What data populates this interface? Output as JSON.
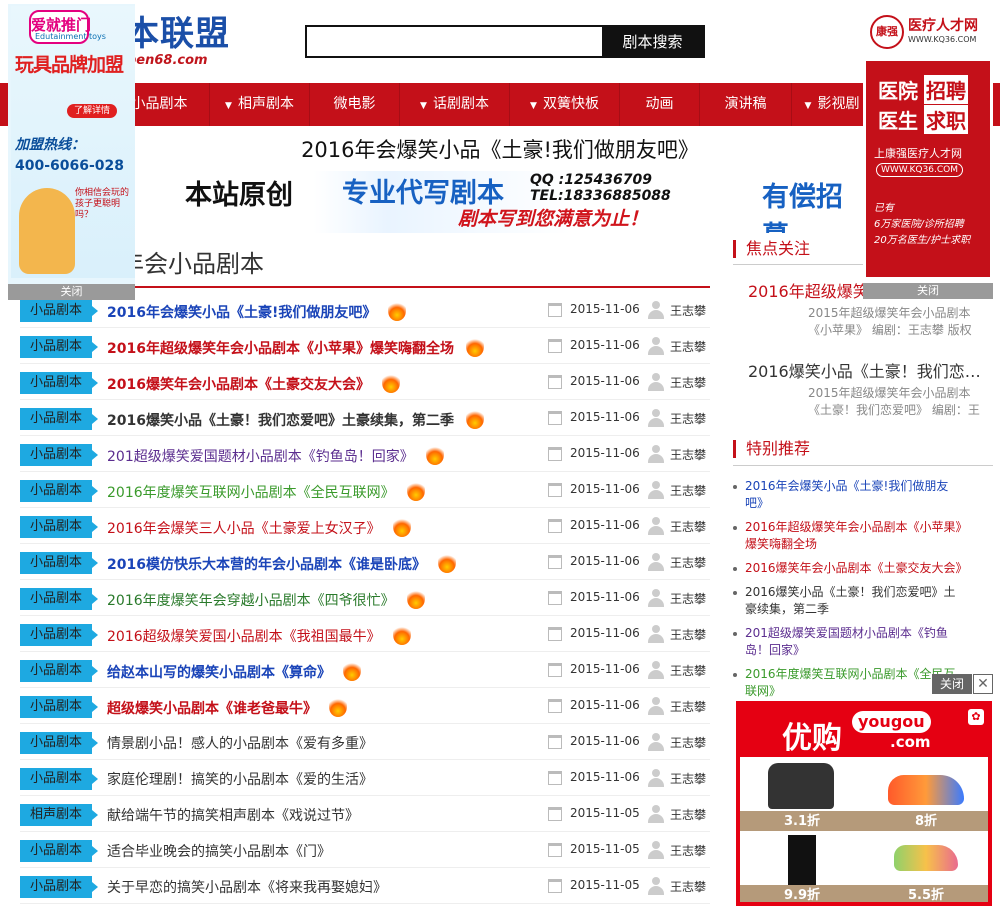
{
  "logo": {
    "text": "本联盟",
    "url_text": "ben68.com"
  },
  "search": {
    "placeholder": "",
    "button": "剧本搜索"
  },
  "nav": [
    "小品剧本",
    "相声剧本",
    "微电影",
    "话剧剧本",
    "双簧快板",
    "动画",
    "演讲稿",
    "影视剧"
  ],
  "article_title": "2016年会爆笑小品《土豪!我们做朋友吧》",
  "banner": {
    "original": "本站原创",
    "service": "专业代写剧本",
    "qq": "QQ :125436709",
    "tel": "TEL:18336885088",
    "slogan": "剧本写到您满意为止！",
    "recruit": "有偿招募"
  },
  "section_title": "年会小品剧本",
  "articles": [
    {
      "tag": "小品剧本",
      "title": "2016年会爆笑小品《土豪!我们做朋友吧》",
      "color": "#1a44b8",
      "bold": true,
      "hot": true,
      "date": "2015-11-06",
      "author": "王志攀"
    },
    {
      "tag": "小品剧本",
      "title": "2016年超级爆笑年会小品剧本《小苹果》爆笑嗨翻全场",
      "color": "#c41019",
      "bold": true,
      "hot": true,
      "date": "2015-11-06",
      "author": "王志攀"
    },
    {
      "tag": "小品剧本",
      "title": "2016爆笑年会小品剧本《土豪交友大会》",
      "color": "#c41019",
      "bold": true,
      "hot": true,
      "date": "2015-11-06",
      "author": "王志攀"
    },
    {
      "tag": "小品剧本",
      "title": "2016爆笑小品《土豪！我们恋爱吧》土豪续集，第二季",
      "color": "#333333",
      "bold": true,
      "hot": true,
      "date": "2015-11-06",
      "author": "王志攀"
    },
    {
      "tag": "小品剧本",
      "title": "201超级爆笑爱国题材小品剧本《钓鱼岛！回家》",
      "color": "#5b2d8f",
      "bold": false,
      "hot": true,
      "date": "2015-11-06",
      "author": "王志攀"
    },
    {
      "tag": "小品剧本",
      "title": "2016年度爆笑互联网小品剧本《全民互联网》",
      "color": "#3a9a2b",
      "bold": false,
      "hot": true,
      "date": "2015-11-06",
      "author": "王志攀"
    },
    {
      "tag": "小品剧本",
      "title": "2016年会爆笑三人小品《土豪爱上女汉子》",
      "color": "#c41019",
      "bold": false,
      "hot": true,
      "date": "2015-11-06",
      "author": "王志攀"
    },
    {
      "tag": "小品剧本",
      "title": "2016模仿快乐大本营的年会小品剧本《谁是卧底》",
      "color": "#1a44b8",
      "bold": true,
      "hot": true,
      "date": "2015-11-06",
      "author": "王志攀"
    },
    {
      "tag": "小品剧本",
      "title": "2016年度爆笑年会穿越小品剧本《四爷很忙》",
      "color": "#2a7a2b",
      "bold": false,
      "hot": true,
      "date": "2015-11-06",
      "author": "王志攀"
    },
    {
      "tag": "小品剧本",
      "title": "2016超级爆笑爱国小品剧本《我祖国最牛》",
      "color": "#c41019",
      "bold": false,
      "hot": true,
      "date": "2015-11-06",
      "author": "王志攀"
    },
    {
      "tag": "小品剧本",
      "title": "给赵本山写的爆笑小品剧本《算命》",
      "color": "#1a44b8",
      "bold": true,
      "hot": true,
      "date": "2015-11-06",
      "author": "王志攀"
    },
    {
      "tag": "小品剧本",
      "title": "超级爆笑小品剧本《谁老爸最牛》",
      "color": "#c41019",
      "bold": true,
      "hot": true,
      "date": "2015-11-06",
      "author": "王志攀"
    },
    {
      "tag": "小品剧本",
      "title": "情景剧小品！感人的小品剧本《爱有多重》",
      "color": "#333333",
      "bold": false,
      "hot": false,
      "date": "2015-11-06",
      "author": "王志攀"
    },
    {
      "tag": "小品剧本",
      "title": "家庭伦理剧！搞笑的小品剧本《爱的生活》",
      "color": "#333333",
      "bold": false,
      "hot": false,
      "date": "2015-11-06",
      "author": "王志攀"
    },
    {
      "tag": "相声剧本",
      "title": "献给端午节的搞笑相声剧本《戏说过节》",
      "color": "#333333",
      "bold": false,
      "hot": false,
      "date": "2015-11-05",
      "author": "王志攀"
    },
    {
      "tag": "小品剧本",
      "title": "适合毕业晚会的搞笑小品剧本《门》",
      "color": "#333333",
      "bold": false,
      "hot": false,
      "date": "2015-11-05",
      "author": "王志攀"
    },
    {
      "tag": "小品剧本",
      "title": "关于早恋的搞笑小品剧本《将来我再娶媳妇》",
      "color": "#333333",
      "bold": false,
      "hot": false,
      "date": "2015-11-05",
      "author": "王志攀"
    }
  ],
  "sidebar": {
    "focus_heading": "焦点关注",
    "focus": [
      {
        "title": "2016年超级爆笑",
        "color": "#c41019",
        "desc1": "2015年超级爆笑年会小品剧本",
        "desc2": "《小苹果》 编剧：王志攀 版权"
      },
      {
        "title": "2016爆笑小品《土豪！我们恋…",
        "color": "#333333",
        "desc1": "2015年超级爆笑年会小品剧本",
        "desc2": "《土豪！我们恋爱吧》 编剧：王"
      }
    ],
    "rec_heading": "特别推荐",
    "recommend": [
      {
        "text": "2016年会爆笑小品《土豪!我们做朋友吧》",
        "color": "#1a44b8"
      },
      {
        "text": "2016年超级爆笑年会小品剧本《小苹果》爆笑嗨翻全场",
        "color": "#c41019"
      },
      {
        "text": "2016爆笑年会小品剧本《土豪交友大会》",
        "color": "#c41019"
      },
      {
        "text": "2016爆笑小品《土豪！我们恋爱吧》土豪续集，第二季",
        "color": "#333333"
      },
      {
        "text": "201超级爆笑爱国题材小品剧本《钓鱼岛！回家》",
        "color": "#5b2d8f"
      },
      {
        "text": "2016年度爆笑互联网小品剧本《全民互联网》",
        "color": "#3a9a2b"
      }
    ]
  },
  "float_left": {
    "title_text": "爱就推门",
    "sub": "Edutainment toys",
    "headline": "玩具品牌加盟",
    "btn": "了解详情",
    "hotline_label": "加盟热线：",
    "hotline": "400-6066-028",
    "bubble": "你相信会玩的孩子更聪明吗？",
    "close": "关闭"
  },
  "float_right": {
    "brand": "康强",
    "title": "医疗人才网",
    "url": "WWW.KQ36.COM",
    "line1": "医院",
    "line1b": "招聘",
    "line2": "医生",
    "line2b": "求职",
    "slogan": "上康强医疗人才网",
    "url2": "WWW.KQ36.COM",
    "note1": "已有",
    "note2": "6万家医院/诊所招聘",
    "note3": "20万名医生/护士求职",
    "close": "关闭"
  },
  "yougou": {
    "close": "关闭",
    "x": "✕",
    "brand_cn": "优购",
    "brand_en": "yougou",
    "brand_tld": ".com",
    "prices": [
      "3.1折",
      "8折",
      "9.9折",
      "5.5折"
    ]
  }
}
